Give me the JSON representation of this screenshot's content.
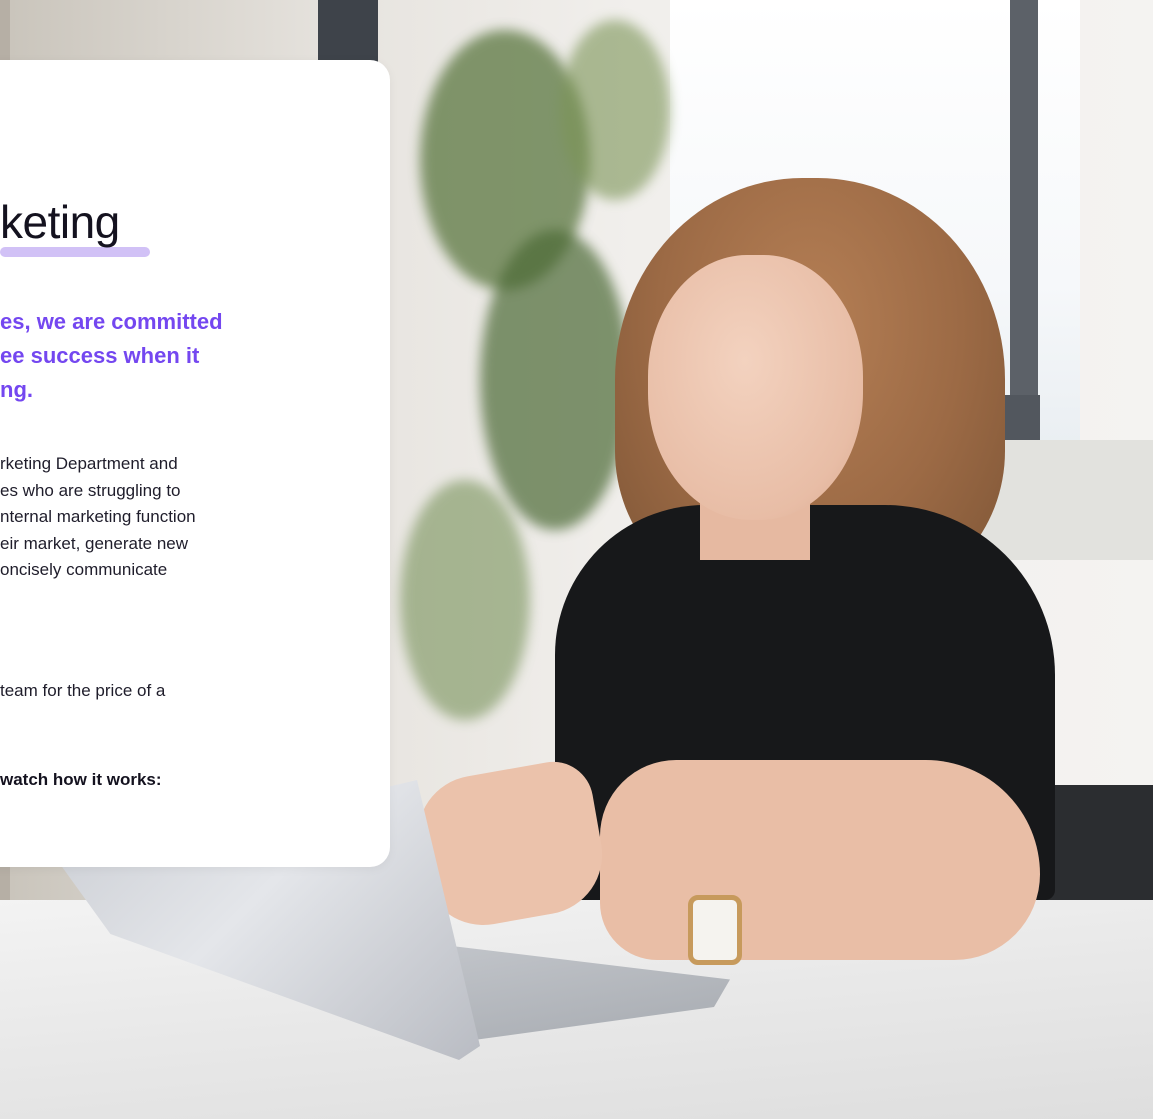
{
  "card": {
    "heading": "keting",
    "lead_lines": [
      "es, we are committed",
      "ee success when it",
      "ng."
    ],
    "body_lines": [
      "rketing Department and",
      "es who are struggling to",
      "nternal marketing function",
      "eir market, generate new",
      "oncisely communicate"
    ],
    "body2_lines": [
      "team for the price of a"
    ],
    "cta": "watch how it works:"
  },
  "colors": {
    "accent": "#7447f0",
    "underline": "#c9b6f4",
    "text": "#14121f",
    "card_bg": "#ffffff"
  }
}
